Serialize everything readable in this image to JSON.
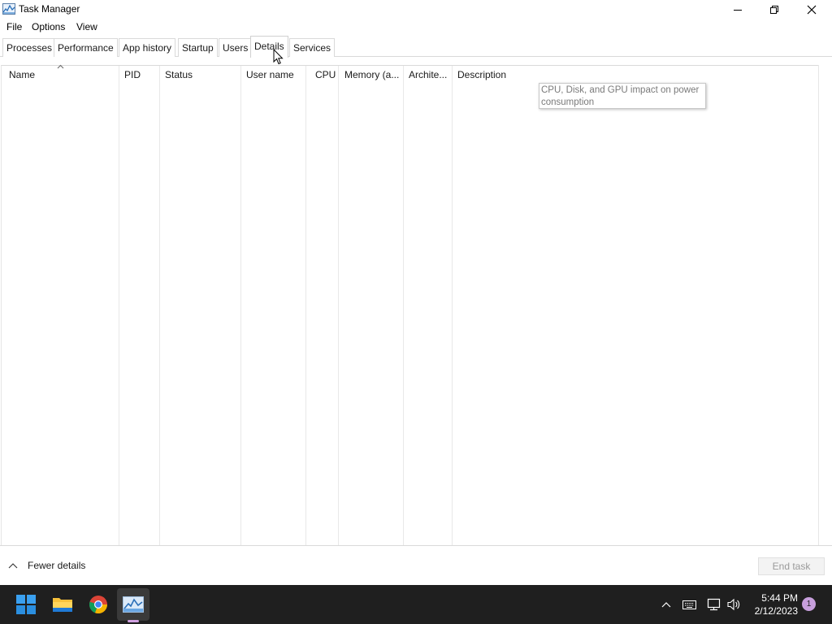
{
  "window": {
    "title": "Task Manager"
  },
  "menu": {
    "items": [
      "File",
      "Options",
      "View"
    ]
  },
  "tabs": [
    {
      "label": "Processes",
      "active": false
    },
    {
      "label": "Performance",
      "active": false
    },
    {
      "label": "App history",
      "active": false
    },
    {
      "label": "Startup",
      "active": false
    },
    {
      "label": "Users",
      "active": false
    },
    {
      "label": "Details",
      "active": true
    },
    {
      "label": "Services",
      "active": false
    }
  ],
  "columns": [
    {
      "label": "Name"
    },
    {
      "label": "PID"
    },
    {
      "label": "Status"
    },
    {
      "label": "User name"
    },
    {
      "label": "CPU"
    },
    {
      "label": "Memory (a..."
    },
    {
      "label": "Archite..."
    },
    {
      "label": "Description"
    }
  ],
  "tooltip": {
    "text": "CPU, Disk, and GPU impact on power consumption"
  },
  "footer": {
    "fewer_details": "Fewer details",
    "end_task": "End task"
  },
  "taskbar": {
    "time": "5:44 PM",
    "date": "2/12/2023",
    "notification_count": "1"
  },
  "colors": {
    "taskbar_bg": "#1f1f1f",
    "accent": "#0078d4",
    "notification_badge": "#c79fdc"
  }
}
